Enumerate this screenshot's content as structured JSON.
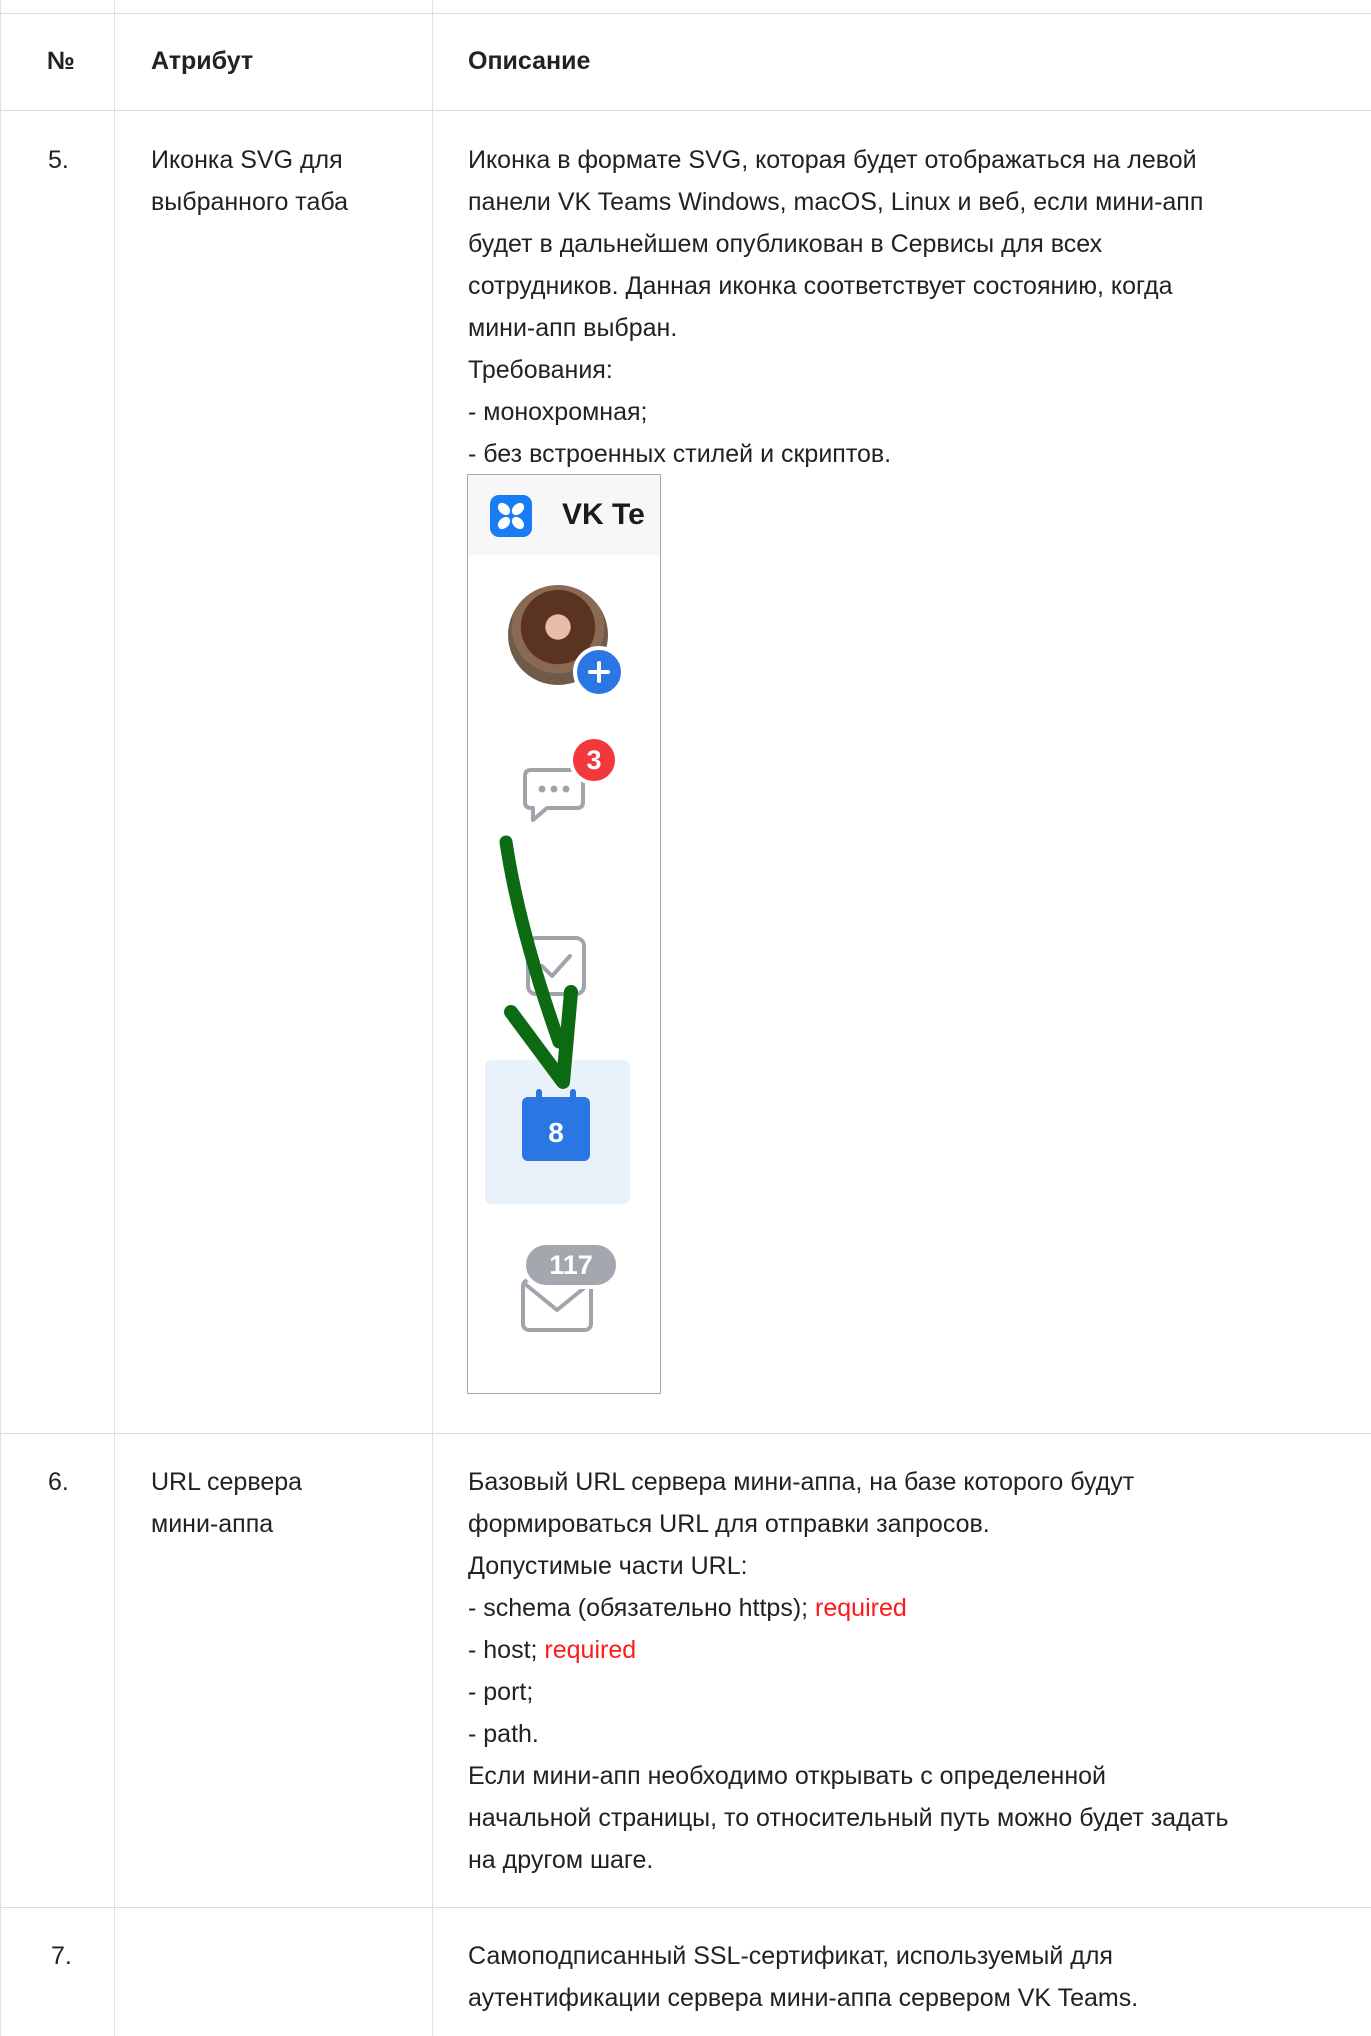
{
  "table": {
    "headers": {
      "num": "№",
      "attribute": "Атрибут",
      "description": "Описание"
    },
    "rows": [
      {
        "num": "5.",
        "attribute_lines": [
          "Иконка SVG для",
          "выбранного таба"
        ],
        "description_lines": [
          "Иконка в формате SVG, которая будет отображаться на левой",
          "панели VK Teams Windows, macOS, Linux и веб, если мини-апп",
          "будет в дальнейшем опубликован в Сервисы для всех",
          "сотрудников. Данная иконка соответствует состоянию, когда",
          "мини-апп выбран.",
          "Требования:",
          "- монохромная;",
          "- без встроенных стилей и скриптов."
        ]
      },
      {
        "num": "6.",
        "attribute_lines": [
          "URL сервера",
          "мини-аппа"
        ],
        "description_lines": [
          "Базовый URL сервера мини-аппа, на базе которого будут",
          "формироваться URL для отправки запросов.",
          "Допустимые части URL:"
        ],
        "schema_line": "- schema (обязательно https); ",
        "schema_required": "required",
        "host_line": "- host; ",
        "host_required": "required",
        "description_lines_after": [
          "- port;",
          "- path.",
          "Если мини-апп необходимо открывать с определенной",
          "начальной страницы, то относительный путь можно будет задать",
          "на другом шаге."
        ]
      },
      {
        "num": "7.",
        "attribute_lines": [],
        "description_lines": [
          "Самоподписанный SSL-сертификат, используемый для",
          "аутентификации сервера мини-аппа сервером VK Teams."
        ]
      }
    ]
  },
  "screenshot": {
    "app_title": "VK Te",
    "chat_badge": "3",
    "calendar_day": "8",
    "mail_badge": "117",
    "colors": {
      "accent_blue": "#2a77e4",
      "badge_red": "#f2383d",
      "arrow_green": "#0c6a12",
      "selected_tile": "#e9f1fb"
    }
  }
}
